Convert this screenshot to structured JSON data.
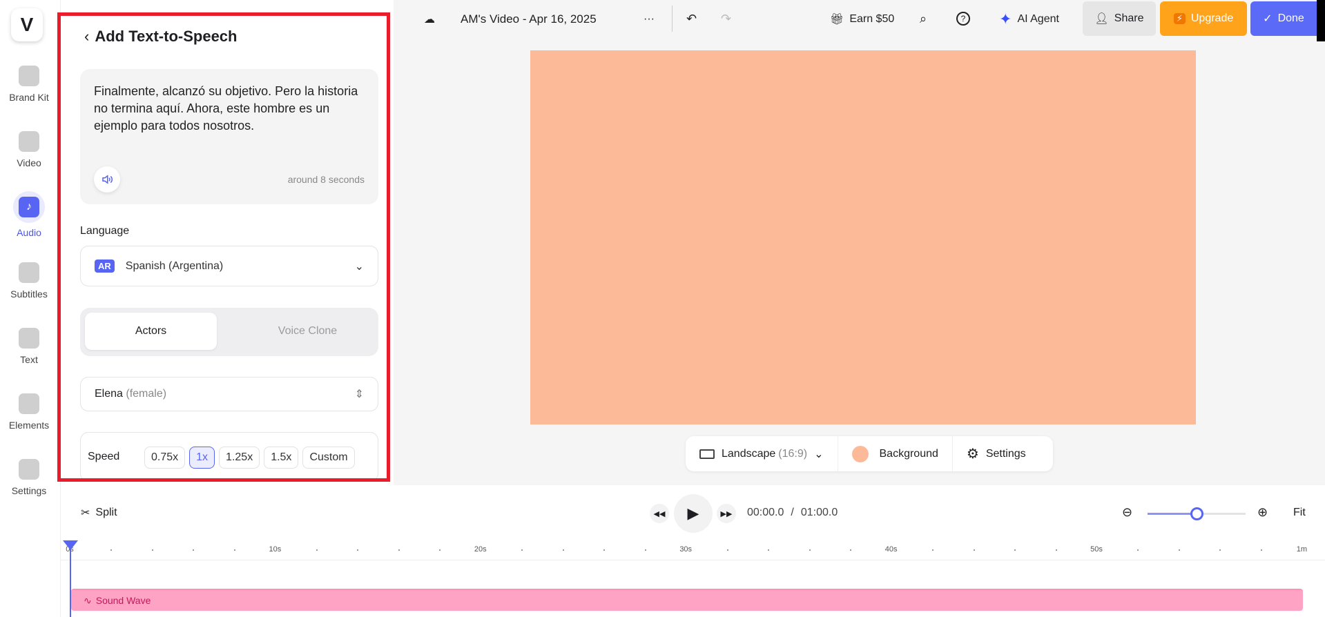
{
  "rail": {
    "logo": "V",
    "items": [
      {
        "label": "Brand Kit",
        "icon": "brand-kit-icon"
      },
      {
        "label": "Video",
        "icon": "video-icon"
      },
      {
        "label": "Audio",
        "icon": "music-note-icon",
        "active": true
      },
      {
        "label": "Subtitles",
        "icon": "subtitles-icon"
      },
      {
        "label": "Text",
        "icon": "text-icon"
      },
      {
        "label": "Elements",
        "icon": "elements-icon"
      },
      {
        "label": "Settings",
        "icon": "settings-icon"
      }
    ]
  },
  "panel": {
    "title": "Add Text-to-Speech",
    "text": "Finalmente, alcanzó su objetivo. Pero la historia no termina aquí. Ahora, este hombre es un ejemplo para todos nosotros.",
    "duration": "around 8 seconds",
    "language_label": "Language",
    "language_code": "AR",
    "language": "Spanish (Argentina)",
    "tabs": [
      "Actors",
      "Voice Clone"
    ],
    "voice_name": "Elena",
    "voice_gender": "(female)",
    "speed_label": "Speed",
    "speeds": [
      "0.75x",
      "1x",
      "1.25x",
      "1.5x",
      "Custom"
    ],
    "selected_speed": "1x"
  },
  "topbar": {
    "title": "AM's Video - Apr 16, 2025",
    "more": "···",
    "earn": "Earn $50",
    "ai_agent": "AI Agent",
    "share": "Share",
    "upgrade": "Upgrade",
    "done": "Done"
  },
  "canvas": {
    "color": "#fdba98"
  },
  "canvas_tools": {
    "format": "Landscape",
    "ratio": "(16:9)",
    "background": "Background",
    "settings": "Settings"
  },
  "timeline": {
    "split": "Split",
    "current": "00:00.0",
    "sep": "/",
    "total": "01:00.0",
    "fit": "Fit",
    "zoom_level": 0.5,
    "ticks": [
      "0s",
      "10s",
      "20s",
      "30s",
      "40s",
      "50s",
      "1m"
    ],
    "track": "Sound Wave"
  }
}
